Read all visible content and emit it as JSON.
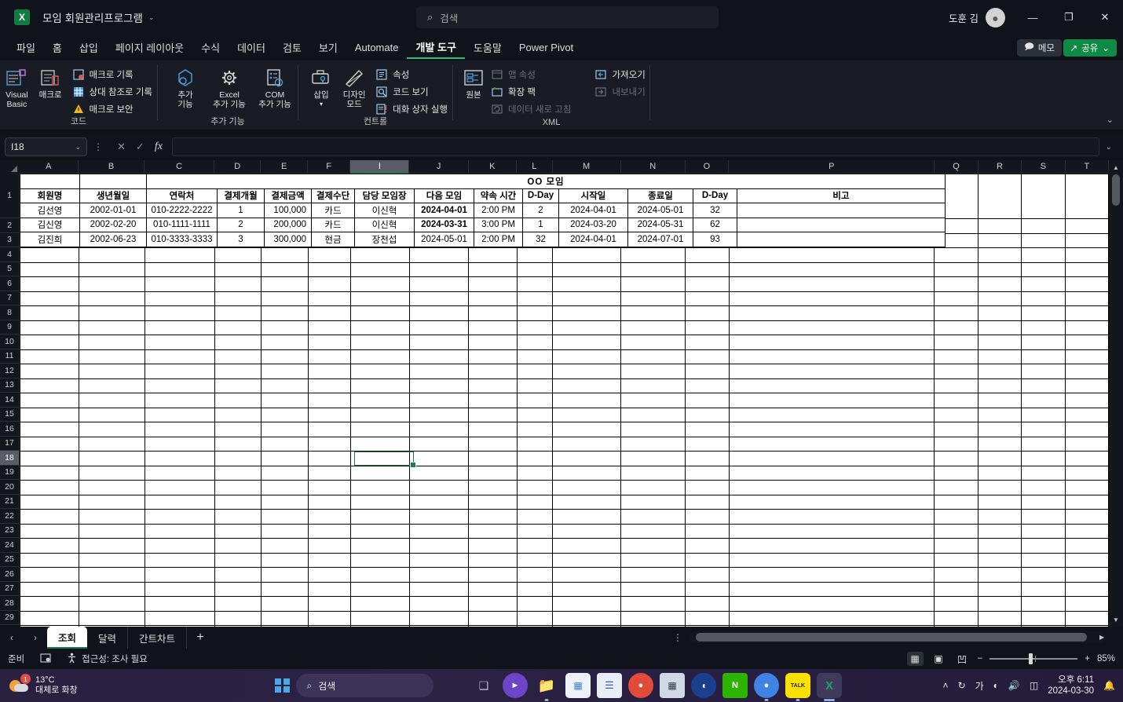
{
  "titlebar": {
    "logo_text": "X",
    "doc_title": "모임 회원관리프로그램",
    "chevron": "⌄",
    "search_placeholder": "검색",
    "search_icon": "⌕",
    "user_name": "도훈 김",
    "minimize": "—",
    "restore": "❐",
    "close": "✕"
  },
  "menu": {
    "tabs": [
      {
        "label": "파일",
        "active": false
      },
      {
        "label": "홈",
        "active": false
      },
      {
        "label": "삽입",
        "active": false
      },
      {
        "label": "페이지 레이아웃",
        "active": false
      },
      {
        "label": "수식",
        "active": false
      },
      {
        "label": "데이터",
        "active": false
      },
      {
        "label": "검토",
        "active": false
      },
      {
        "label": "보기",
        "active": false
      },
      {
        "label": "Automate",
        "active": false
      },
      {
        "label": "개발 도구",
        "active": true
      },
      {
        "label": "도움말",
        "active": false
      },
      {
        "label": "Power Pivot",
        "active": false
      }
    ],
    "memo_label": "메모",
    "share_label": "공유",
    "share_chevron": "⌄"
  },
  "ribbon": {
    "collapse_icon": "⌄",
    "groups": [
      {
        "name": "코드",
        "big_buttons": [
          {
            "label": "Visual\nBasic",
            "icon": "visual-basic-icon"
          },
          {
            "label": "매크로",
            "icon": "macro-icon"
          }
        ],
        "small_buttons": [
          {
            "label": "매크로 기록",
            "dim": false
          },
          {
            "label": "상대 참조로 기록",
            "dim": false
          },
          {
            "label": "매크로 보안",
            "dim": false
          }
        ]
      },
      {
        "name": "추가 기능",
        "big_buttons": [
          {
            "label": "추가\n기능",
            "icon": "addin-icon"
          },
          {
            "label": "Excel\n추가 기능",
            "icon": "excel-addin-icon"
          },
          {
            "label": "COM\n추가 기능",
            "icon": "com-addin-icon"
          }
        ],
        "small_buttons": []
      },
      {
        "name": "컨트롤",
        "big_buttons": [
          {
            "label": "삽입",
            "icon": "insert-control-icon"
          },
          {
            "label": "디자인\n모드",
            "icon": "design-mode-icon"
          }
        ],
        "small_buttons": [
          {
            "label": "속성",
            "dim": false
          },
          {
            "label": "코드 보기",
            "dim": false
          },
          {
            "label": "대화 상자 실행",
            "dim": false
          }
        ]
      },
      {
        "name": "XML",
        "big_buttons": [
          {
            "label": "원본",
            "icon": "xml-source-icon"
          }
        ],
        "small_buttons": [
          {
            "label": "맵 속성",
            "dim": true
          },
          {
            "label": "확장 팩",
            "dim": false
          },
          {
            "label": "데이터 새로 고침",
            "dim": true
          }
        ],
        "small_buttons2": [
          {
            "label": "가져오기",
            "dim": false
          },
          {
            "label": "내보내기",
            "dim": true
          }
        ]
      }
    ]
  },
  "formula_bar": {
    "name_box_value": "I18",
    "name_box_chevron": "⌄",
    "cancel_icon": "✕",
    "confirm_icon": "✓",
    "fx_icon": "fx",
    "formula_value": "",
    "expand_chevron": "⌄"
  },
  "grid": {
    "columns": [
      "A",
      "B",
      "C",
      "D",
      "E",
      "F",
      "I",
      "J",
      "K",
      "L",
      "M",
      "N",
      "O",
      "P",
      "Q",
      "R",
      "S",
      "T"
    ],
    "selected_column": "I",
    "rows": [
      1,
      2,
      3,
      4,
      5,
      6,
      7,
      8,
      9,
      10,
      11,
      12,
      13,
      14,
      15,
      16,
      17,
      18,
      19,
      20,
      21,
      22,
      23,
      24,
      25,
      26,
      27,
      28,
      29
    ],
    "selected_row": 18,
    "selected_cell": "I18",
    "sheet_title": "OO 모임",
    "headers": [
      "회원명",
      "생년월일",
      "연락처",
      "결제개월",
      "결제금액",
      "결제수단",
      "담당 모임장",
      "다음 모임",
      "약속 시간",
      "D-Day",
      "시작일",
      "종료일",
      "D-Day",
      "비고"
    ],
    "data_rows": [
      {
        "cells": [
          "김선영",
          "2002-01-01",
          "010-2222-2222",
          "1",
          "100,000",
          "카드",
          "이신혁",
          "2024-04-01",
          "2:00 PM",
          "2",
          "2024-04-01",
          "2024-05-01",
          "32",
          ""
        ],
        "highlight": {
          "index": 7,
          "color": "green"
        }
      },
      {
        "cells": [
          "김신영",
          "2002-02-20",
          "010-1111-1111",
          "2",
          "200,000",
          "카드",
          "이신혁",
          "2024-03-31",
          "3:00 PM",
          "1",
          "2024-03-20",
          "2024-05-31",
          "62",
          ""
        ],
        "highlight": {
          "index": 7,
          "color": "red"
        }
      },
      {
        "cells": [
          "김진희",
          "2002-06-23",
          "010-3333-3333",
          "3",
          "300,000",
          "현금",
          "장천섭",
          "2024-05-01",
          "2:00 PM",
          "32",
          "2024-04-01",
          "2024-07-01",
          "93",
          ""
        ],
        "highlight": null
      }
    ],
    "colors": {
      "header_fill": "#fdf0c9",
      "green_fill": "#a9f0a9",
      "red_fill": "#f9a0a4",
      "selection_border": "#1f7a4d"
    }
  },
  "sheet_tabs": {
    "prev_icon": "‹",
    "next_icon": "›",
    "tabs": [
      {
        "label": "조회",
        "active": true
      },
      {
        "label": "달력",
        "active": false
      },
      {
        "label": "간트차트",
        "active": false
      }
    ],
    "add_label": "+",
    "more_icon": "⋮"
  },
  "status_bar": {
    "ready_label": "준비",
    "record_macro_icon": "record-macro-icon",
    "accessibility_label": "접근성: 조사 필요",
    "view_buttons": [
      {
        "name": "normal-view",
        "icon": "▦",
        "active": true
      },
      {
        "name": "page-layout-view",
        "icon": "▣",
        "active": false
      },
      {
        "name": "page-break-view",
        "icon": "凹",
        "active": false
      }
    ],
    "zoom_out": "−",
    "zoom_in": "+",
    "zoom_level": "85%"
  },
  "taskbar": {
    "weather_temp": "13°C",
    "weather_desc": "대체로 화창",
    "weather_badge": "1",
    "search_label": "검색",
    "search_icon": "⌕",
    "apps": [
      {
        "name": "task-view-icon",
        "glyph": "❐",
        "color": "#9aa0ac",
        "dot": false
      },
      {
        "name": "meet-icon",
        "glyph": "◉",
        "color": "#7b4fd6",
        "dot": false
      },
      {
        "name": "file-explorer-icon",
        "glyph": "🗀",
        "color": "#f5b73c",
        "dot": true
      },
      {
        "name": "microsoft-store-icon",
        "glyph": "▤",
        "color": "#e9eef5",
        "dot": false
      },
      {
        "name": "notepad-icon",
        "glyph": "▤",
        "color": "#4a7ad6",
        "dot": false
      },
      {
        "name": "chrome-icon",
        "glyph": "◉",
        "color": "#e24a3a",
        "dot": false
      },
      {
        "name": "calculator-icon",
        "glyph": "▦",
        "color": "#6fb4dd",
        "dot": false
      },
      {
        "name": "whale-browser-icon",
        "glyph": "◗",
        "color": "#2a5fb4",
        "dot": false
      },
      {
        "name": "naver-office-icon",
        "glyph": "N",
        "color": "#2db400",
        "dot": false
      },
      {
        "name": "chrome-badge-icon",
        "glyph": "◉",
        "color": "#3f84e4",
        "dot": true
      },
      {
        "name": "kakaotalk-icon",
        "glyph": "TALK",
        "color": "#fae100",
        "dot": true
      },
      {
        "name": "excel-taskbar-icon",
        "glyph": "X",
        "color": "#107c41",
        "dot": true
      }
    ],
    "tray": {
      "overflow_icon": "˄",
      "onedrive_icon": "↻",
      "ime_icon": "가",
      "wifi_icon": "◣",
      "volume_icon": "◂))",
      "battery_icon": "▭",
      "time": "오후 6:11",
      "date": "2024-03-30",
      "notification_icon": "🔔"
    }
  }
}
